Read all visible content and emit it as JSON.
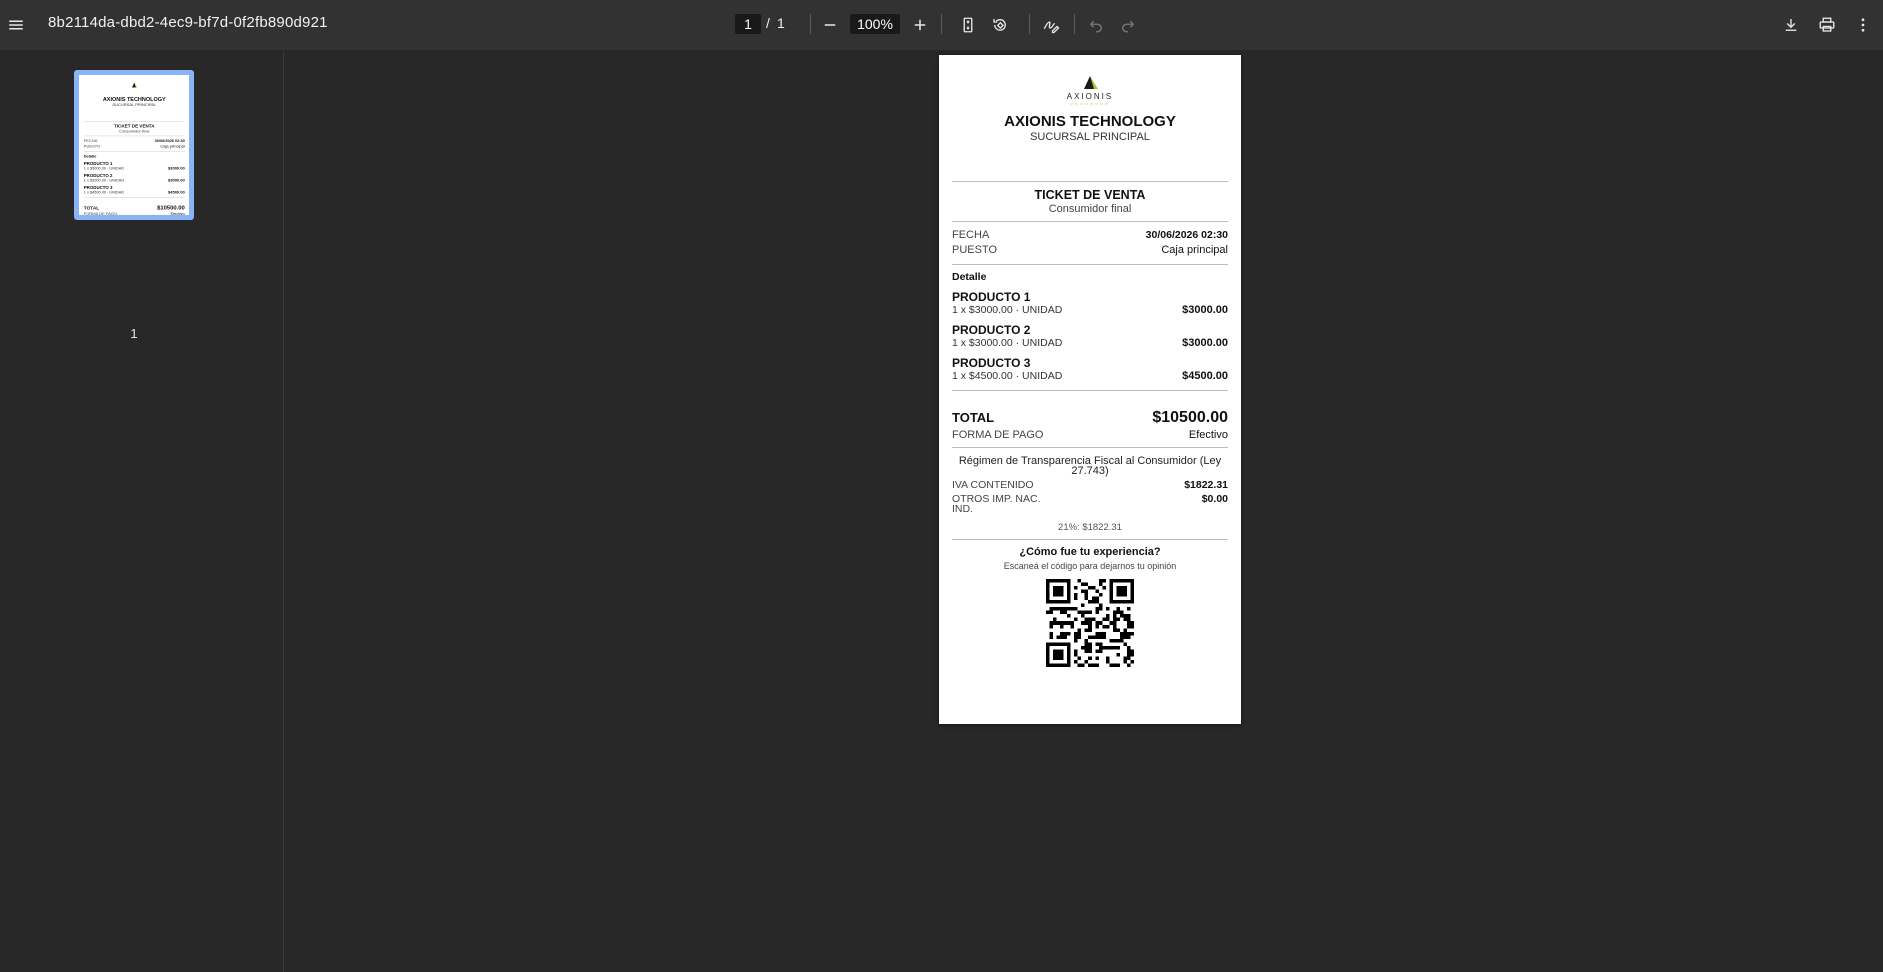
{
  "toolbar": {
    "doc_title": "8b2114da-dbd2-4ec9-bf7d-0f2fb890d921",
    "current_page": "1",
    "page_separator": "/",
    "total_pages": "1",
    "zoom": "100%"
  },
  "sidebar": {
    "thumbnail_page_number": "1"
  },
  "receipt": {
    "logo_text": "AXIONIS",
    "company": "AXIONIS TECHNOLOGY",
    "branch": "SUCURSAL PRINCIPAL",
    "ticket_title": "TICKET DE VENTA",
    "ticket_subtitle": "Consumidor final",
    "fecha_label": "FECHA",
    "fecha_value": "30/06/2026 02:30",
    "puesto_label": "PUESTO",
    "puesto_value": "Caja principal",
    "detalle_label": "Detalle",
    "products": [
      {
        "name": "PRODUCTO 1",
        "line": "1 x $3000.00 · UNIDAD",
        "amount": "$3000.00"
      },
      {
        "name": "PRODUCTO 2",
        "line": "1 x $3000.00 · UNIDAD",
        "amount": "$3000.00"
      },
      {
        "name": "PRODUCTO 3",
        "line": "1 x $4500.00 · UNIDAD",
        "amount": "$4500.00"
      }
    ],
    "total_label": "TOTAL",
    "total_value": "$10500.00",
    "pago_label": "FORMA DE PAGO",
    "pago_value": "Efectivo",
    "regimen": "Régimen de Transparencia Fiscal al Consumidor (Ley 27.743)",
    "iva_label": "IVA CONTENIDO",
    "iva_value": "$1822.31",
    "otros_label": "OTROS IMP. NAC. IND.",
    "otros_value": "$0.00",
    "tax_note": "21%: $1822.31",
    "exp_title": "¿Cómo fue tu experiencia?",
    "exp_sub": "Escaneá el código para dejarnos tu opinión"
  },
  "colors": {
    "toolbar_bg": "#323232",
    "viewer_bg": "#282828",
    "thumb_border": "#8ab4f8",
    "logo_accent": "#a4c639"
  },
  "icons": [
    "menu-icon",
    "zoom-out-icon",
    "zoom-in-icon",
    "fit-page-icon",
    "rotate-icon",
    "annotate-icon",
    "undo-icon",
    "redo-icon",
    "download-icon",
    "print-icon",
    "more-vert-icon"
  ]
}
